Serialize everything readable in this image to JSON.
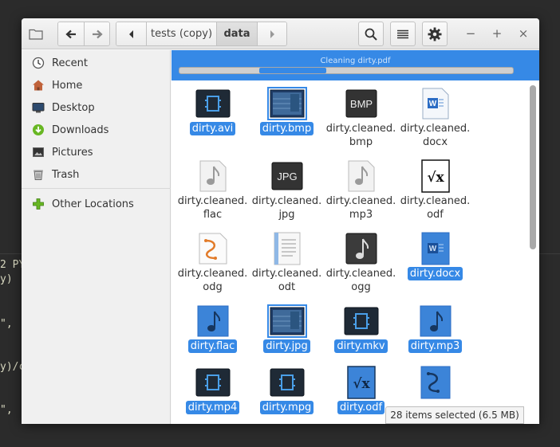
{
  "terminal": {
    "lines": [
      "2 PY",
      "y)",
      "\",",
      "y)/c",
      "\","
    ]
  },
  "header": {
    "breadcrumb": [
      "tests (copy)",
      "data"
    ],
    "icons": {
      "folder": "folder-icon",
      "back": "arrow-left-icon",
      "forward": "arrow-right-icon",
      "crumb_prev": "chevron-left-icon",
      "crumb_next": "chevron-right-icon",
      "search": "search-icon",
      "view": "list-view-icon",
      "menu": "gear-icon",
      "minimize": "minimize-icon",
      "maximize": "maximize-icon",
      "close": "close-icon"
    },
    "window_controls": [
      "−",
      "+",
      "×"
    ]
  },
  "sidebar": {
    "items": [
      {
        "label": "Recent",
        "icon": "clock-icon"
      },
      {
        "label": "Home",
        "icon": "home-icon"
      },
      {
        "label": "Desktop",
        "icon": "desktop-icon"
      },
      {
        "label": "Downloads",
        "icon": "download-icon"
      },
      {
        "label": "Pictures",
        "icon": "pictures-icon"
      },
      {
        "label": "Trash",
        "icon": "trash-icon"
      },
      {
        "label": "Other Locations",
        "icon": "plus-icon"
      }
    ]
  },
  "progress": {
    "label": "Cleaning dirty.pdf",
    "fill_start": 0.24,
    "fill_fraction": 0.2,
    "color": "#3689e6"
  },
  "files": [
    {
      "name": "dirty.avi",
      "type": "video",
      "selected": true
    },
    {
      "name": "dirty.bmp",
      "type": "image",
      "selected": true
    },
    {
      "name": "dirty.cleaned.\nbmp",
      "type": "bmp",
      "selected": false
    },
    {
      "name": "dirty.cleaned.\ndocx",
      "type": "docx",
      "selected": false
    },
    {
      "name": "dirty.cleaned.\nflac",
      "type": "audio",
      "selected": false
    },
    {
      "name": "dirty.cleaned.\njpg",
      "type": "jpg",
      "selected": false
    },
    {
      "name": "dirty.cleaned.\nmp3",
      "type": "audio",
      "selected": false
    },
    {
      "name": "dirty.cleaned.\nodf",
      "type": "formula",
      "selected": false
    },
    {
      "name": "dirty.cleaned.\nodg",
      "type": "drawing",
      "selected": false
    },
    {
      "name": "dirty.cleaned.\nodt",
      "type": "text",
      "selected": false
    },
    {
      "name": "dirty.cleaned.\nogg",
      "type": "audio-dark",
      "selected": false
    },
    {
      "name": "dirty.docx",
      "type": "docx",
      "selected": true
    },
    {
      "name": "dirty.flac",
      "type": "audio",
      "selected": true
    },
    {
      "name": "dirty.jpg",
      "type": "image",
      "selected": true
    },
    {
      "name": "dirty.mkv",
      "type": "video",
      "selected": true
    },
    {
      "name": "dirty.mp3",
      "type": "audio",
      "selected": true
    },
    {
      "name": "dirty.mp4",
      "type": "video",
      "selected": true
    },
    {
      "name": "dirty.mpg",
      "type": "video",
      "selected": true
    },
    {
      "name": "dirty.odf",
      "type": "formula",
      "selected": true
    },
    {
      "name": "",
      "type": "drawing",
      "selected": true
    }
  ],
  "status": {
    "text": "28 items selected  (6.5 MB)"
  },
  "colors": {
    "accent": "#3689e6",
    "selected_text": "#ffffff"
  }
}
